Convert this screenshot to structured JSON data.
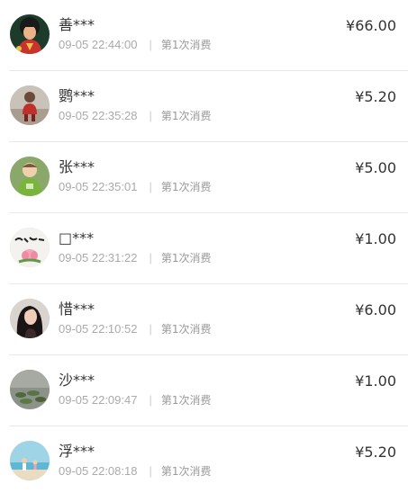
{
  "donations": [
    {
      "name": "善***",
      "time": "09-05 22:44:00",
      "count": "第1次消费",
      "amount": "¥66.00",
      "avatar": "avatar-girl-red-icon"
    },
    {
      "name": "鹦***",
      "time": "09-05 22:35:28",
      "count": "第1次消费",
      "amount": "¥5.20",
      "avatar": "avatar-child-red-icon"
    },
    {
      "name": "张***",
      "time": "09-05 22:35:01",
      "count": "第1次消费",
      "amount": "¥5.00",
      "avatar": "avatar-baby-green-icon"
    },
    {
      "name": "□***",
      "time": "09-05 22:31:22",
      "count": "第1次消费",
      "amount": "¥1.00",
      "avatar": "avatar-lotus-calligraphy-icon"
    },
    {
      "name": "惜***",
      "time": "09-05 22:10:52",
      "count": "第1次消费",
      "amount": "¥6.00",
      "avatar": "avatar-woman-icon"
    },
    {
      "name": "沙***",
      "time": "09-05 22:09:47",
      "count": "第1次消费",
      "amount": "¥1.00",
      "avatar": "avatar-lotus-pond-icon"
    },
    {
      "name": "浮***",
      "time": "09-05 22:08:18",
      "count": "第1次消费",
      "amount": "¥5.20",
      "avatar": "avatar-beach-icon"
    }
  ],
  "separator": "|"
}
